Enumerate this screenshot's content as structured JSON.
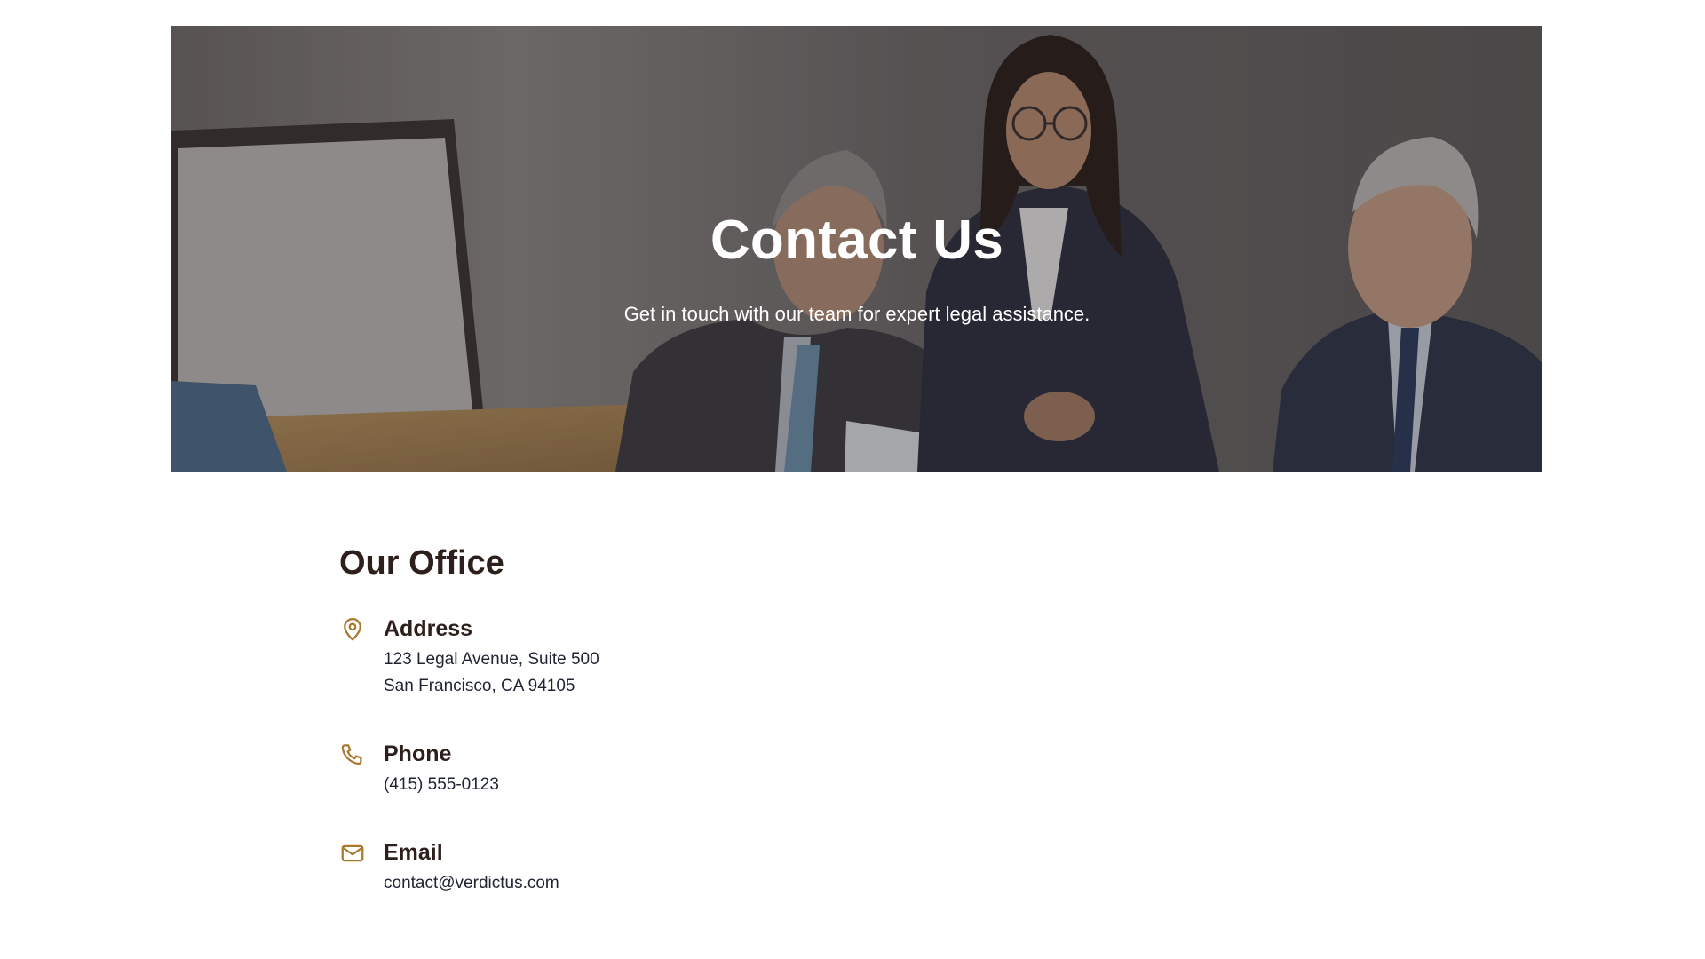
{
  "hero": {
    "title": "Contact Us",
    "subtitle": "Get in touch with our team for expert legal assistance."
  },
  "office": {
    "heading": "Our Office",
    "items": [
      {
        "icon": "map-pin-icon",
        "title": "Address",
        "lines": [
          "123 Legal Avenue, Suite 500",
          "San Francisco, CA 94105"
        ]
      },
      {
        "icon": "phone-icon",
        "title": "Phone",
        "lines": [
          "(415) 555-0123"
        ]
      },
      {
        "icon": "mail-icon",
        "title": "Email",
        "lines": [
          "contact@verdictus.com"
        ]
      }
    ]
  },
  "colors": {
    "accent": "#a8782e",
    "heading": "#2d1f1b",
    "body_text": "#1f2433",
    "hero_text": "#ffffff"
  }
}
